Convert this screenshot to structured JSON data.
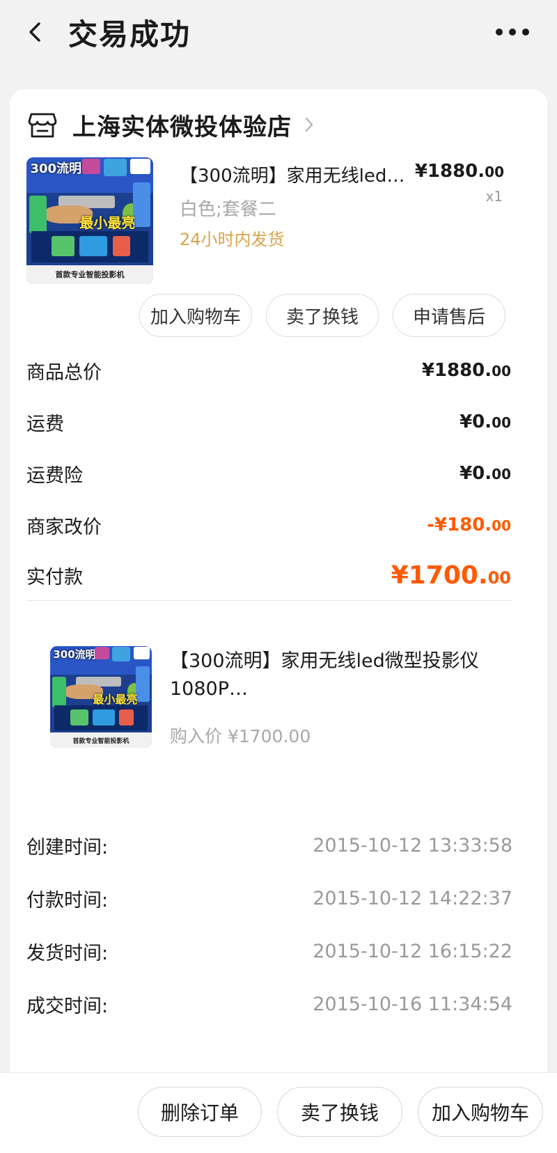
{
  "header": {
    "title": "交易成功"
  },
  "shop": {
    "name": "上海实体微投体验店"
  },
  "product": {
    "name": "【300流明】家用无线led…",
    "price_main": "¥1880.",
    "price_dec": "00",
    "qty": "x1",
    "spec": "白色;套餐二",
    "shipping": "24小时内发货",
    "image": {
      "badge": "300流明",
      "slogan": "最小最亮",
      "caption": "首款专业智能投影机"
    }
  },
  "actions": [
    "加入购物车",
    "卖了换钱",
    "申请售后"
  ],
  "summary": [
    {
      "label": "商品总价",
      "main": "¥1880.",
      "dec": "00"
    },
    {
      "label": "运费",
      "main": "¥0.",
      "dec": "00"
    },
    {
      "label": "运费险",
      "main": "¥0.",
      "dec": "00"
    },
    {
      "label": "商家改价",
      "main": "-¥180.",
      "dec": "00"
    },
    {
      "label": "实付款",
      "main": "¥1700.",
      "dec": "00"
    }
  ],
  "popup": {
    "name": "【300流明】家用无线led微型投影仪1080P…",
    "price": "购入价 ¥1700.00"
  },
  "times": [
    {
      "label": "创建时间:",
      "value": "2015-10-12 13:33:58"
    },
    {
      "label": "付款时间:",
      "value": "2015-10-12 14:22:37"
    },
    {
      "label": "发货时间:",
      "value": "2015-10-12 16:15:22"
    },
    {
      "label": "成交时间:",
      "value": "2015-10-16 11:34:54"
    }
  ],
  "bottom_actions": [
    "删除订单",
    "卖了换钱",
    "加入购物车"
  ],
  "colors": {
    "accent": "#ff5a00",
    "ship": "#d8a44a",
    "muted": "#999999"
  }
}
